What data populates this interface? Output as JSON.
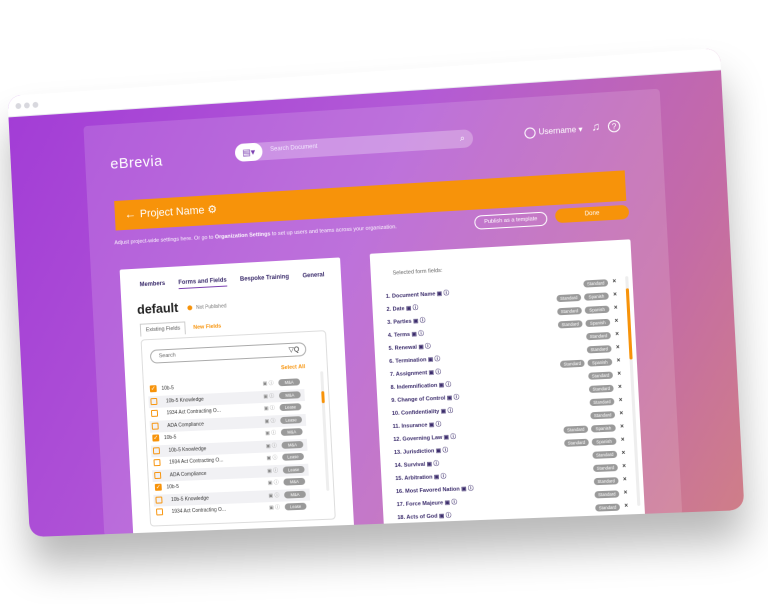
{
  "app": {
    "brand": "eBrevia",
    "search_placeholder": "Search Document",
    "username": "Username ▾",
    "project_title": "Project Name ⚙",
    "hint_prefix": "Adjust project-wide settings here. Or go to ",
    "hint_link": "Organization Settings",
    "hint_suffix": " to set up users and teams across your organization.",
    "publish_label": "Publish as a template",
    "done_label": "Done"
  },
  "left": {
    "tabs": [
      "Members",
      "Forms and Fields",
      "Bespoke Training",
      "General"
    ],
    "form_name": "default",
    "status": "Not Published",
    "subtabs": [
      "Existing Fields",
      "New Fields"
    ],
    "search_placeholder": "Search",
    "filter_icon": "▽Q",
    "select_all": "Select All",
    "rows": [
      {
        "label": "10b-5",
        "tag": "M&A",
        "checked": true
      },
      {
        "label": "10b-5 Knowledge",
        "tag": "M&A",
        "checked": false
      },
      {
        "label": "1934 Act Contracting O...",
        "tag": "Lease",
        "checked": false
      },
      {
        "label": "ADA Compliance",
        "tag": "Lease",
        "checked": false
      },
      {
        "label": "10b-5",
        "tag": "M&A",
        "checked": true
      },
      {
        "label": "10b-5 Knowledge",
        "tag": "M&A",
        "checked": false
      },
      {
        "label": "1934 Act Contracting O...",
        "tag": "Lease",
        "checked": false
      },
      {
        "label": "ADA Compliance",
        "tag": "Lease",
        "checked": false
      },
      {
        "label": "10b-5",
        "tag": "M&A",
        "checked": true
      },
      {
        "label": "10b-5 Knowledge",
        "tag": "M&A",
        "checked": false
      },
      {
        "label": "1934 Act Contracting O...",
        "tag": "Lease",
        "checked": false
      }
    ]
  },
  "right": {
    "header": "Selected form fields:",
    "fields": [
      {
        "label": "1. Document Name",
        "tags": [
          "Standard"
        ]
      },
      {
        "label": "2. Date",
        "tags": [
          "Standard",
          "Spanish"
        ]
      },
      {
        "label": "3. Parties",
        "tags": [
          "Standard",
          "Spanish"
        ]
      },
      {
        "label": "4. Terms",
        "tags": [
          "Standard",
          "Spanish"
        ]
      },
      {
        "label": "5. Renewal",
        "tags": [
          "Standard"
        ]
      },
      {
        "label": "6. Termination",
        "tags": [
          "Standard"
        ]
      },
      {
        "label": "7. Assignment",
        "tags": [
          "Standard",
          "Spanish"
        ]
      },
      {
        "label": "8. Indemnification",
        "tags": [
          "Standard"
        ]
      },
      {
        "label": "9. Change of Control",
        "tags": [
          "Standard"
        ]
      },
      {
        "label": "10. Confidentiality",
        "tags": [
          "Standard"
        ]
      },
      {
        "label": "11. Insurance",
        "tags": [
          "Standard"
        ]
      },
      {
        "label": "12. Governing Law",
        "tags": [
          "Standard",
          "Spanish"
        ]
      },
      {
        "label": "13. Jurisdiction",
        "tags": [
          "Standard",
          "Spanish"
        ]
      },
      {
        "label": "14. Survival",
        "tags": [
          "Standard"
        ]
      },
      {
        "label": "15. Arbitration",
        "tags": [
          "Standard"
        ]
      },
      {
        "label": "16. Most Favored Nation",
        "tags": [
          "Standard"
        ]
      },
      {
        "label": "17. Force Majeure",
        "tags": [
          "Standard"
        ]
      },
      {
        "label": "18. Acts of God",
        "tags": [
          "Standard"
        ]
      }
    ]
  },
  "colors": {
    "accent": "#f7930a",
    "purple": "#7b3fb0"
  }
}
